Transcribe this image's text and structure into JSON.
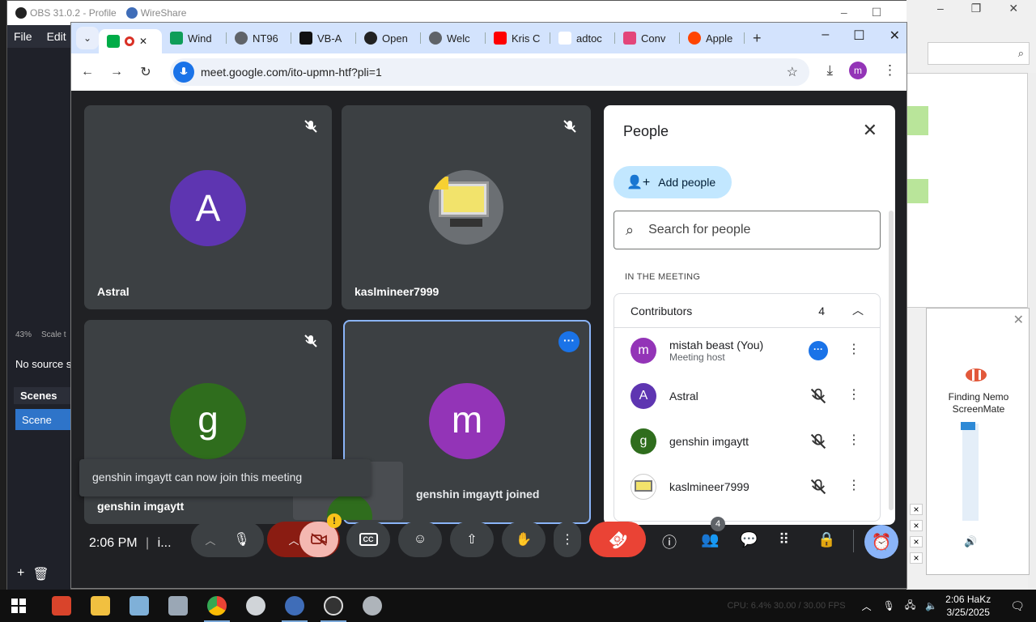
{
  "obs": {
    "title": "OBS 31.0.2 - Profile",
    "menu": [
      "File",
      "Edit"
    ],
    "zoom": "43%",
    "scale_label": "Scale t",
    "no_source": "No source s",
    "scenes_header": "Scenes",
    "scene_item": "Scene"
  },
  "wireshare": {
    "title": "WireShare"
  },
  "chrome": {
    "tabs": [
      {
        "label": "",
        "icon": "meet-icon",
        "color": "#00ac47",
        "active": true
      },
      {
        "label": "Wind",
        "icon": "sheets-icon",
        "color": "#0f9d58"
      },
      {
        "label": "NT96",
        "icon": "globe-icon",
        "color": "#5f6368"
      },
      {
        "label": "VB-A",
        "icon": "vb-icon",
        "color": "#111111"
      },
      {
        "label": "Open",
        "icon": "openai-icon",
        "color": "#222222"
      },
      {
        "label": "Welc",
        "icon": "globe-icon",
        "color": "#5f6368"
      },
      {
        "label": "Kris C",
        "icon": "youtube-icon",
        "color": "#ff0000"
      },
      {
        "label": "adtoc",
        "icon": "blank-icon",
        "color": "#ffffff"
      },
      {
        "label": "Conv",
        "icon": "convert-icon",
        "color": "#e3467a"
      },
      {
        "label": "Apple",
        "icon": "reddit-icon",
        "color": "#ff4500"
      }
    ],
    "url": "meet.google.com/ito-upmn-htf?pli=1",
    "profile_initial": "m"
  },
  "meet": {
    "tiles": [
      {
        "name": "Astral",
        "initial": "A",
        "color": "#5e35b1"
      },
      {
        "name": "kaslmineer7999",
        "initial": "",
        "color": ""
      },
      {
        "name": "genshin imgaytt",
        "initial": "g",
        "color": "#2f6d1d"
      },
      {
        "name": "",
        "initial": "m",
        "color": "#9334b7"
      }
    ],
    "toast": "genshin imgaytt can now join this meeting",
    "joined_notice": "genshin imgaytt joined",
    "time": "2:06 PM",
    "meeting_code_short": "i...",
    "people_count_badge": "4"
  },
  "people": {
    "title": "People",
    "add_label": "Add people",
    "search_placeholder": "Search for people",
    "section": "IN THE MEETING",
    "group_label": "Contributors",
    "group_count": "4",
    "members": [
      {
        "name": "mistah beast (You)",
        "sub": "Meeting host",
        "initial": "m",
        "color": "#9334b7"
      },
      {
        "name": "Astral",
        "sub": "",
        "initial": "A",
        "color": "#5e35b1"
      },
      {
        "name": "genshin imgaytt",
        "sub": "",
        "initial": "g",
        "color": "#2f6d1d"
      },
      {
        "name": "kaslmineer7999",
        "sub": "",
        "initial": "",
        "color": ""
      }
    ]
  },
  "nemo": {
    "title_line1": "Finding Nemo",
    "title_line2": "ScreenMate"
  },
  "taskbar": {
    "status": "CPU: 6.4%   30.00 / 30.00 FPS",
    "time": "2:06 HaKz",
    "date": "3/25/2025"
  }
}
